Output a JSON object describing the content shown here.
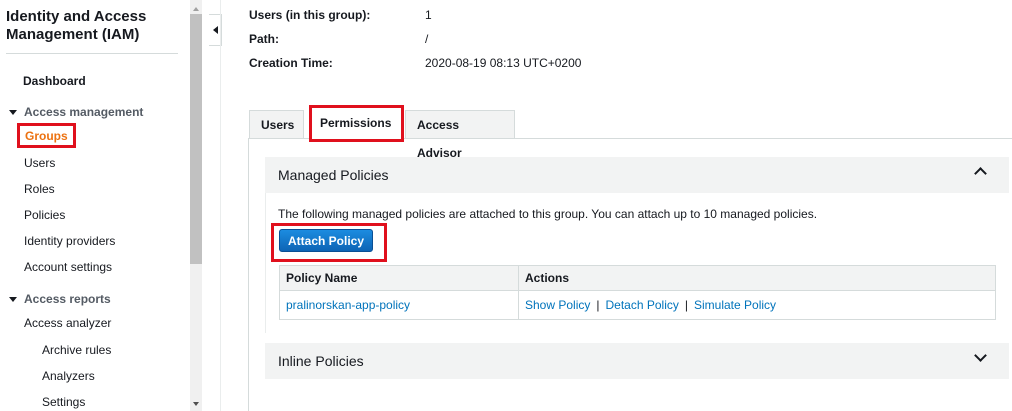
{
  "sidebar": {
    "title": "Identity and Access Management (IAM)",
    "dashboard": "Dashboard",
    "access_management": "Access management",
    "items": [
      "Groups",
      "Users",
      "Roles",
      "Policies",
      "Identity providers",
      "Account settings"
    ],
    "access_reports": "Access reports",
    "report_items": [
      "Access analyzer"
    ],
    "analyzer_subitems": [
      "Archive rules",
      "Analyzers",
      "Settings"
    ]
  },
  "info": {
    "users_label": "Users (in this group):",
    "users_value": "1",
    "path_label": "Path:",
    "path_value": "/",
    "created_label": "Creation Time:",
    "created_value": "2020-08-19 08:13 UTC+0200"
  },
  "tabs": {
    "users": "Users",
    "permissions": "Permissions",
    "advisor": "Access Advisor"
  },
  "managed": {
    "title": "Managed Policies",
    "description": "The following managed policies are attached to this group. You can attach up to 10 managed policies.",
    "attach_label": "Attach Policy",
    "col_name": "Policy Name",
    "col_actions": "Actions",
    "rows": [
      {
        "name": "pralinorskan-app-policy",
        "show": "Show Policy",
        "detach": "Detach Policy",
        "simulate": "Simulate Policy",
        "sep": "|"
      }
    ]
  },
  "inline": {
    "title": "Inline Policies"
  },
  "colors": {
    "highlight": "#e0101d",
    "selected_item": "#ec7211",
    "link": "#0073bb",
    "button": "#1c8ce0"
  }
}
